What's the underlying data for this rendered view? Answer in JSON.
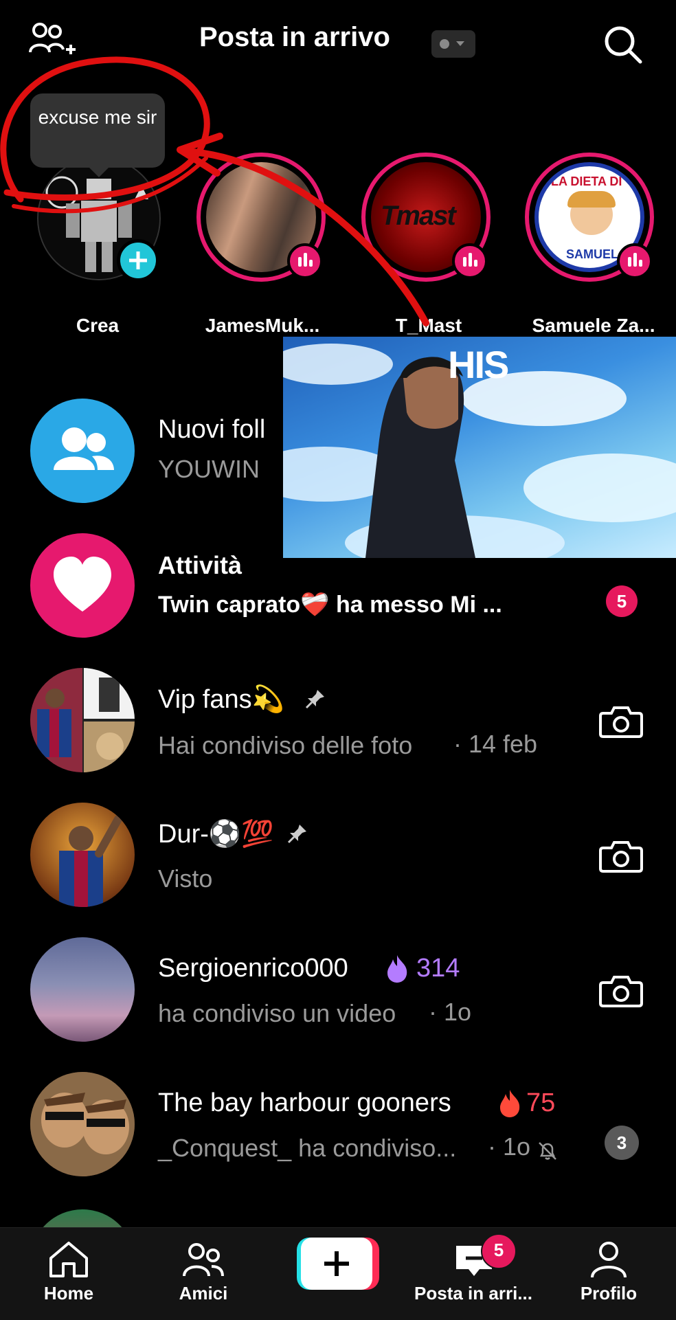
{
  "header": {
    "title": "Posta in arrivo"
  },
  "tooltip": {
    "text": "excuse me sir"
  },
  "overlay": {
    "caption": "HIS"
  },
  "stories": [
    {
      "label": "Crea"
    },
    {
      "label": "JamesMuk..."
    },
    {
      "label": "T_Mast"
    },
    {
      "label": "Samuele Za..."
    }
  ],
  "story_logos": {
    "tmast": "Tmast",
    "dieta_line1": "LA DIETA DI",
    "dieta_line2": "SAMUEL"
  },
  "rows": [
    {
      "title": "Nuovi foll",
      "subtitle": "YOUWIN"
    },
    {
      "title": "Attività",
      "subtitle": "Twin caprato❤️‍🩹 ha messo Mi ...",
      "badge": "5"
    },
    {
      "title": "Vip fans💫",
      "subtitle": "Hai condiviso delle foto",
      "time": "· 14 feb"
    },
    {
      "title": "Dur-⚽💯",
      "subtitle": "Visto"
    },
    {
      "title": "Sergioenrico000",
      "streak": "314",
      "subtitle": "ha condiviso un video",
      "time": "· 1o"
    },
    {
      "title": "The bay harbour gooners",
      "streak": "75",
      "subtitle": "_Conquest_ ha condiviso...",
      "time": "· 1o",
      "badge": "3"
    }
  ],
  "bottom_nav": {
    "home": "Home",
    "friends": "Amici",
    "inbox": "Posta in arri...",
    "inbox_badge": "5",
    "profile": "Profilo"
  },
  "colors": {
    "accent_pink": "#e6196e",
    "follow_blue": "#29a9e8",
    "streak_purple": "#b47cff",
    "streak_red": "#ff4a5a"
  }
}
